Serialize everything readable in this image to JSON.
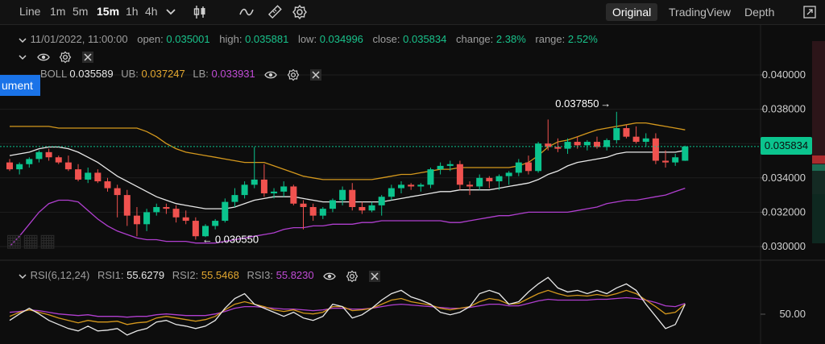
{
  "toolbar": {
    "timeframes": [
      "Line",
      "1m",
      "5m",
      "15m",
      "1h",
      "4h"
    ],
    "active_timeframe": "15m",
    "views": [
      "Original",
      "TradingView",
      "Depth"
    ],
    "active_view": "Original",
    "icons": [
      "chevron-down-icon",
      "candlestick-icon",
      "indicator-wave-icon",
      "draw-ruler-icon",
      "settings-gear-icon",
      "fullscreen-icon"
    ]
  },
  "ohlc": {
    "datetime": "11/01/2022, 11:00:00",
    "open_label": "open:",
    "open": "0.035001",
    "high_label": "high:",
    "high": "0.035881",
    "low_label": "low:",
    "low": "0.034996",
    "close_label": "close:",
    "close": "0.035834",
    "change_label": "change:",
    "change": "2.38%",
    "range_label": "range:",
    "range": "2.52%"
  },
  "boll": {
    "name": "BOLL",
    "value": "0.035589",
    "ub_label": "UB:",
    "ub": "0.037247",
    "lb_label": "LB:",
    "lb": "0.033931"
  },
  "rsi": {
    "name": "RSI(6,12,24)",
    "rsi1_label": "RSI1:",
    "rsi1": "55.6279",
    "rsi2_label": "RSI2:",
    "rsi2": "55.5468",
    "rsi3_label": "RSI3:",
    "rsi3": "55.8230",
    "axis_label": "50.00"
  },
  "instrument_tag": "ument",
  "current_price": "0.035834",
  "annotations": {
    "high": "0.037850",
    "low": "0.030550"
  },
  "price_axis": {
    "ticks": [
      {
        "label": "0.040000",
        "value": 0.04
      },
      {
        "label": "0.038000",
        "value": 0.038
      },
      {
        "label": "0.036000",
        "value": 0.036
      },
      {
        "label": "0.034000",
        "value": 0.034
      },
      {
        "label": "0.032000",
        "value": 0.032
      },
      {
        "label": "0.030000",
        "value": 0.03
      }
    ]
  },
  "colors": {
    "up": "#0bc48e",
    "down": "#f0524f",
    "mid": "#e8e8e8",
    "upper_band": "#d4981d",
    "lower_band": "#b03fcf",
    "bg": "#0d0d0d",
    "grid": "#1f1f1f",
    "active_tag": "#1a73e8"
  },
  "chart_data": {
    "type": "candlestick",
    "candles": [
      {
        "o": 0.0349,
        "h": 0.0351,
        "l": 0.0344,
        "c": 0.0345
      },
      {
        "o": 0.0345,
        "h": 0.0349,
        "l": 0.0342,
        "c": 0.0348
      },
      {
        "o": 0.0348,
        "h": 0.0352,
        "l": 0.0346,
        "c": 0.0351
      },
      {
        "o": 0.0351,
        "h": 0.0356,
        "l": 0.0349,
        "c": 0.0355
      },
      {
        "o": 0.0355,
        "h": 0.0357,
        "l": 0.035,
        "c": 0.0352
      },
      {
        "o": 0.0352,
        "h": 0.0353,
        "l": 0.0348,
        "c": 0.0349
      },
      {
        "o": 0.0349,
        "h": 0.0353,
        "l": 0.0344,
        "c": 0.0345
      },
      {
        "o": 0.0345,
        "h": 0.0348,
        "l": 0.0338,
        "c": 0.0339
      },
      {
        "o": 0.0339,
        "h": 0.0346,
        "l": 0.0337,
        "c": 0.0343
      },
      {
        "o": 0.0343,
        "h": 0.0345,
        "l": 0.0337,
        "c": 0.0338
      },
      {
        "o": 0.0338,
        "h": 0.034,
        "l": 0.0332,
        "c": 0.0334
      },
      {
        "o": 0.0334,
        "h": 0.0336,
        "l": 0.0317,
        "c": 0.033
      },
      {
        "o": 0.033,
        "h": 0.0333,
        "l": 0.0312,
        "c": 0.0318
      },
      {
        "o": 0.0318,
        "h": 0.0323,
        "l": 0.0306,
        "c": 0.0313
      },
      {
        "o": 0.0313,
        "h": 0.0322,
        "l": 0.0309,
        "c": 0.032
      },
      {
        "o": 0.032,
        "h": 0.0325,
        "l": 0.0318,
        "c": 0.0323
      },
      {
        "o": 0.0323,
        "h": 0.0325,
        "l": 0.0319,
        "c": 0.0322
      },
      {
        "o": 0.0322,
        "h": 0.0324,
        "l": 0.0314,
        "c": 0.0317
      },
      {
        "o": 0.0317,
        "h": 0.0321,
        "l": 0.0313,
        "c": 0.0315
      },
      {
        "o": 0.0315,
        "h": 0.0317,
        "l": 0.0304,
        "c": 0.0306
      },
      {
        "o": 0.0306,
        "h": 0.0313,
        "l": 0.03055,
        "c": 0.0312
      },
      {
        "o": 0.0312,
        "h": 0.0316,
        "l": 0.031,
        "c": 0.0315
      },
      {
        "o": 0.0315,
        "h": 0.0328,
        "l": 0.0314,
        "c": 0.0326
      },
      {
        "o": 0.0326,
        "h": 0.0334,
        "l": 0.0323,
        "c": 0.033
      },
      {
        "o": 0.033,
        "h": 0.0338,
        "l": 0.0328,
        "c": 0.0336
      },
      {
        "o": 0.0336,
        "h": 0.0358,
        "l": 0.0334,
        "c": 0.0339
      },
      {
        "o": 0.0339,
        "h": 0.0348,
        "l": 0.0329,
        "c": 0.0331
      },
      {
        "o": 0.0331,
        "h": 0.0334,
        "l": 0.0328,
        "c": 0.0332
      },
      {
        "o": 0.0332,
        "h": 0.0338,
        "l": 0.0329,
        "c": 0.0335
      },
      {
        "o": 0.0335,
        "h": 0.0336,
        "l": 0.0324,
        "c": 0.0325
      },
      {
        "o": 0.0325,
        "h": 0.0327,
        "l": 0.031,
        "c": 0.0323
      },
      {
        "o": 0.0323,
        "h": 0.0325,
        "l": 0.0315,
        "c": 0.0318
      },
      {
        "o": 0.0318,
        "h": 0.0323,
        "l": 0.0316,
        "c": 0.0322
      },
      {
        "o": 0.0322,
        "h": 0.0328,
        "l": 0.032,
        "c": 0.0327
      },
      {
        "o": 0.0327,
        "h": 0.0335,
        "l": 0.0324,
        "c": 0.0333
      },
      {
        "o": 0.0333,
        "h": 0.0337,
        "l": 0.0321,
        "c": 0.0323
      },
      {
        "o": 0.0323,
        "h": 0.0326,
        "l": 0.0319,
        "c": 0.0321
      },
      {
        "o": 0.0321,
        "h": 0.0326,
        "l": 0.032,
        "c": 0.0324
      },
      {
        "o": 0.0324,
        "h": 0.033,
        "l": 0.0318,
        "c": 0.0329
      },
      {
        "o": 0.0329,
        "h": 0.0336,
        "l": 0.0327,
        "c": 0.0334
      },
      {
        "o": 0.0334,
        "h": 0.0338,
        "l": 0.0331,
        "c": 0.0336
      },
      {
        "o": 0.0336,
        "h": 0.0337,
        "l": 0.0333,
        "c": 0.0335
      },
      {
        "o": 0.0335,
        "h": 0.0337,
        "l": 0.0332,
        "c": 0.0336
      },
      {
        "o": 0.0336,
        "h": 0.0346,
        "l": 0.0334,
        "c": 0.0345
      },
      {
        "o": 0.0345,
        "h": 0.0349,
        "l": 0.0342,
        "c": 0.0347
      },
      {
        "o": 0.0347,
        "h": 0.035,
        "l": 0.0344,
        "c": 0.0348
      },
      {
        "o": 0.0348,
        "h": 0.035,
        "l": 0.0333,
        "c": 0.0336
      },
      {
        "o": 0.0336,
        "h": 0.0338,
        "l": 0.033,
        "c": 0.0335
      },
      {
        "o": 0.0335,
        "h": 0.0342,
        "l": 0.0333,
        "c": 0.034
      },
      {
        "o": 0.034,
        "h": 0.0341,
        "l": 0.0334,
        "c": 0.0338
      },
      {
        "o": 0.0338,
        "h": 0.0342,
        "l": 0.0333,
        "c": 0.0341
      },
      {
        "o": 0.0341,
        "h": 0.0344,
        "l": 0.0336,
        "c": 0.0343
      },
      {
        "o": 0.0343,
        "h": 0.0351,
        "l": 0.0341,
        "c": 0.0349
      },
      {
        "o": 0.0349,
        "h": 0.0353,
        "l": 0.0342,
        "c": 0.0344
      },
      {
        "o": 0.0344,
        "h": 0.0361,
        "l": 0.0343,
        "c": 0.036
      },
      {
        "o": 0.036,
        "h": 0.0374,
        "l": 0.0356,
        "c": 0.0358
      },
      {
        "o": 0.0358,
        "h": 0.0363,
        "l": 0.0355,
        "c": 0.0357
      },
      {
        "o": 0.0357,
        "h": 0.0363,
        "l": 0.0354,
        "c": 0.0361
      },
      {
        "o": 0.0361,
        "h": 0.0364,
        "l": 0.0357,
        "c": 0.0359
      },
      {
        "o": 0.0359,
        "h": 0.0362,
        "l": 0.0356,
        "c": 0.0361
      },
      {
        "o": 0.0361,
        "h": 0.0364,
        "l": 0.0357,
        "c": 0.0358
      },
      {
        "o": 0.0358,
        "h": 0.0363,
        "l": 0.0356,
        "c": 0.0362
      },
      {
        "o": 0.0362,
        "h": 0.03785,
        "l": 0.036,
        "c": 0.0369
      },
      {
        "o": 0.0369,
        "h": 0.0371,
        "l": 0.0363,
        "c": 0.0364
      },
      {
        "o": 0.0364,
        "h": 0.037,
        "l": 0.036,
        "c": 0.0361
      },
      {
        "o": 0.0361,
        "h": 0.0366,
        "l": 0.0358,
        "c": 0.0363
      },
      {
        "o": 0.0363,
        "h": 0.0366,
        "l": 0.0348,
        "c": 0.035
      },
      {
        "o": 0.035,
        "h": 0.0356,
        "l": 0.0346,
        "c": 0.0349
      },
      {
        "o": 0.0349,
        "h": 0.0354,
        "l": 0.0347,
        "c": 0.0352
      },
      {
        "o": 0.035,
        "h": 0.03588,
        "l": 0.03499,
        "c": 0.03583
      }
    ],
    "boll_mid": [
      0.0353,
      0.0354,
      0.0355,
      0.0357,
      0.0358,
      0.0358,
      0.0357,
      0.0355,
      0.0352,
      0.0349,
      0.0345,
      0.0341,
      0.0338,
      0.0335,
      0.0332,
      0.0329,
      0.0327,
      0.0325,
      0.0324,
      0.0323,
      0.0322,
      0.0322,
      0.0322,
      0.0323,
      0.0325,
      0.0327,
      0.0328,
      0.0329,
      0.0329,
      0.0329,
      0.0328,
      0.0327,
      0.0326,
      0.0326,
      0.0326,
      0.0326,
      0.0326,
      0.0326,
      0.0326,
      0.0327,
      0.0328,
      0.0329,
      0.033,
      0.0331,
      0.0332,
      0.0332,
      0.0333,
      0.0333,
      0.0333,
      0.0333,
      0.0334,
      0.0335,
      0.0336,
      0.0337,
      0.0339,
      0.0342,
      0.0344,
      0.0347,
      0.0349,
      0.035,
      0.0351,
      0.0352,
      0.0354,
      0.0355,
      0.0355,
      0.0355,
      0.0355,
      0.0355,
      0.0355,
      0.0356
    ],
    "boll_upper": [
      0.037,
      0.037,
      0.037,
      0.037,
      0.037,
      0.0369,
      0.0369,
      0.0369,
      0.0369,
      0.0369,
      0.0369,
      0.0369,
      0.0369,
      0.0369,
      0.0367,
      0.0364,
      0.036,
      0.0357,
      0.0355,
      0.0354,
      0.0353,
      0.0352,
      0.0351,
      0.035,
      0.0349,
      0.0349,
      0.0349,
      0.0347,
      0.0345,
      0.0343,
      0.0341,
      0.034,
      0.0339,
      0.0339,
      0.0339,
      0.0339,
      0.0339,
      0.0339,
      0.034,
      0.0341,
      0.0342,
      0.0342,
      0.0343,
      0.0344,
      0.0345,
      0.0345,
      0.0346,
      0.0346,
      0.0346,
      0.0346,
      0.0346,
      0.0346,
      0.0347,
      0.0349,
      0.0353,
      0.0358,
      0.0361,
      0.0362,
      0.0364,
      0.0366,
      0.0368,
      0.0369,
      0.037,
      0.0371,
      0.0372,
      0.0372,
      0.0371,
      0.037,
      0.0369,
      0.0368
    ],
    "boll_lower": [
      0.03,
      0.0306,
      0.0313,
      0.032,
      0.0325,
      0.0327,
      0.0327,
      0.0326,
      0.0321,
      0.0316,
      0.0312,
      0.0309,
      0.0307,
      0.0305,
      0.0304,
      0.0304,
      0.0303,
      0.0303,
      0.0303,
      0.0302,
      0.0302,
      0.0302,
      0.0303,
      0.0304,
      0.0305,
      0.0306,
      0.0307,
      0.0308,
      0.031,
      0.0311,
      0.0311,
      0.0312,
      0.0312,
      0.0313,
      0.0313,
      0.0313,
      0.0314,
      0.0314,
      0.0315,
      0.0315,
      0.0315,
      0.0315,
      0.0315,
      0.0315,
      0.0315,
      0.0314,
      0.0314,
      0.0315,
      0.0316,
      0.0317,
      0.0318,
      0.0318,
      0.0319,
      0.032,
      0.032,
      0.032,
      0.032,
      0.032,
      0.0321,
      0.0322,
      0.0323,
      0.0325,
      0.0326,
      0.0327,
      0.0327,
      0.0328,
      0.0329,
      0.033,
      0.0332,
      0.0334
    ],
    "rsi1": [
      35,
      43,
      50,
      43,
      35,
      30,
      25,
      22,
      28,
      22,
      23,
      25,
      17,
      22,
      25,
      33,
      35,
      30,
      28,
      25,
      28,
      35,
      50,
      62,
      68,
      55,
      50,
      45,
      40,
      45,
      38,
      35,
      40,
      55,
      52,
      38,
      42,
      50,
      60,
      68,
      72,
      64,
      60,
      55,
      45,
      42,
      45,
      52,
      68,
      72,
      68,
      55,
      58,
      70,
      80,
      88,
      75,
      70,
      72,
      68,
      72,
      68,
      75,
      80,
      72,
      55,
      40,
      25,
      30,
      55
    ],
    "rsi2": [
      40,
      45,
      48,
      45,
      42,
      38,
      35,
      32,
      35,
      33,
      33,
      34,
      30,
      32,
      33,
      38,
      40,
      38,
      36,
      34,
      36,
      40,
      48,
      55,
      58,
      55,
      52,
      48,
      46,
      48,
      44,
      43,
      45,
      52,
      52,
      47,
      48,
      50,
      55,
      60,
      62,
      58,
      56,
      54,
      50,
      48,
      50,
      52,
      58,
      62,
      60,
      55,
      56,
      62,
      68,
      72,
      68,
      65,
      66,
      65,
      67,
      65,
      68,
      72,
      68,
      60,
      52,
      43,
      45,
      55
    ],
    "rsi3": [
      45,
      46,
      48,
      47,
      45,
      43,
      42,
      41,
      42,
      40,
      40,
      40,
      39,
      40,
      40,
      42,
      43,
      42,
      41,
      41,
      41,
      43,
      46,
      50,
      52,
      52,
      51,
      50,
      49,
      49,
      48,
      47,
      48,
      50,
      50,
      49,
      49,
      50,
      52,
      54,
      55,
      54,
      53,
      52,
      51,
      50,
      50,
      51,
      53,
      55,
      55,
      53,
      53,
      56,
      59,
      61,
      60,
      60,
      60,
      60,
      61,
      61,
      62,
      63,
      62,
      60,
      57,
      53,
      52,
      56
    ],
    "rsi_ylim": [
      0,
      100
    ]
  }
}
